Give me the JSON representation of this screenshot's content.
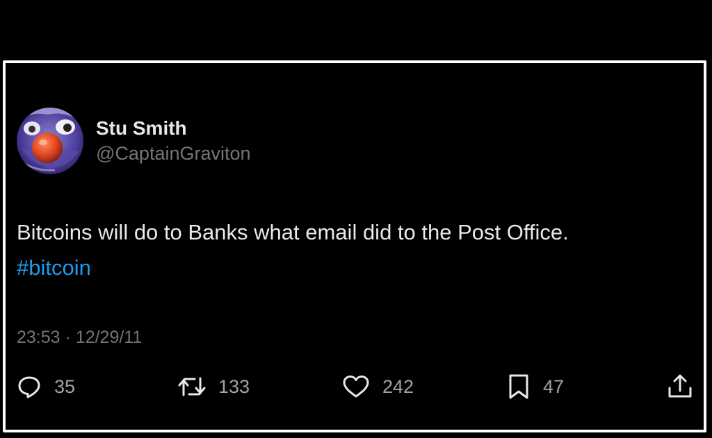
{
  "tweet": {
    "author": {
      "display_name": "Stu Smith",
      "handle": "@CaptainGraviton",
      "avatar_icon": "clown-avatar"
    },
    "text": "Bitcoins will do to Banks what email did to the Post Office.",
    "hashtag": "#bitcoin",
    "time": "23:53",
    "separator": "·",
    "date": "12/29/11",
    "actions": {
      "reply": {
        "icon": "reply-icon",
        "count": "35"
      },
      "retweet": {
        "icon": "retweet-icon",
        "count": "133"
      },
      "like": {
        "icon": "heart-icon",
        "count": "242"
      },
      "bookmark": {
        "icon": "bookmark-icon",
        "count": "47"
      },
      "share": {
        "icon": "share-icon"
      }
    }
  },
  "colors": {
    "background": "#000000",
    "frame_border": "#ffffff",
    "text": "#e7e9ea",
    "secondary_text": "#71767b",
    "hashtag": "#1d9bf0"
  }
}
